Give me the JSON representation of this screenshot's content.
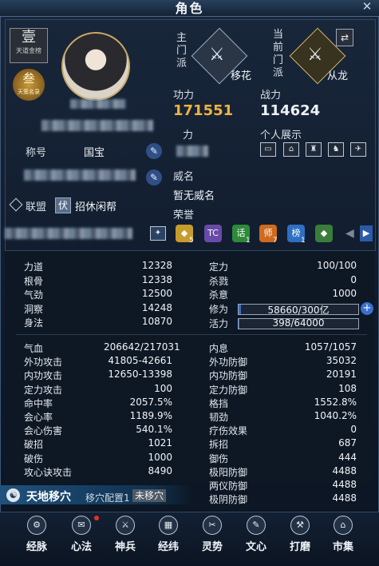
{
  "window": {
    "title": "角色",
    "close_icon": "close-icon"
  },
  "badges": {
    "rank_big": "壹",
    "rank_small": "天道金榜",
    "seal_big": "叁",
    "seal_small": "天策名录"
  },
  "profile": {
    "title_label": "称号",
    "title_value": "国宝",
    "alliance_label": "联盟",
    "alliance_tag": "伏",
    "alliance_value": "招休闲帮"
  },
  "school": {
    "main_label_lines": [
      "主",
      "门",
      "派"
    ],
    "main_name": "移花",
    "current_label_lines": [
      "当",
      "前",
      "门",
      "派"
    ],
    "current_name": "从龙"
  },
  "power": {
    "gongli_label": "功力",
    "gongli_value": "171551",
    "zhanli_label": "战力",
    "zhanli_value": "114624",
    "hidden_label_suffix": "力",
    "personal_label": "个人展示"
  },
  "weiming": {
    "label": "威名",
    "value": "暂无威名"
  },
  "honor": {
    "label": "荣誉",
    "items": [
      {
        "icon": "honor-diamond-5",
        "text": "",
        "count": "5",
        "color": "#c79c2c"
      },
      {
        "icon": "honor-tc",
        "text": "TC",
        "count": "",
        "color": "#6a4aa8"
      },
      {
        "icon": "honor-hua",
        "text": "话",
        "count": "1",
        "color": "#2e8a3a"
      },
      {
        "icon": "honor-shi",
        "text": "师",
        "count": "7",
        "color": "#cf6a1f"
      },
      {
        "icon": "honor-bang",
        "text": "榜",
        "count": "1",
        "color": "#2d6fc2"
      },
      {
        "icon": "honor-frog",
        "text": "",
        "count": "",
        "color": "#3a7d3a"
      }
    ]
  },
  "attrs_left": [
    {
      "k": "力道",
      "v": "12328"
    },
    {
      "k": "根骨",
      "v": "12338"
    },
    {
      "k": "气劲",
      "v": "12500"
    },
    {
      "k": "洞察",
      "v": "14248"
    },
    {
      "k": "身法",
      "v": "10870"
    }
  ],
  "attrs_right": [
    {
      "k": "定力",
      "v": "100/100"
    },
    {
      "k": "杀戮",
      "v": "0"
    },
    {
      "k": "杀意",
      "v": "1000"
    }
  ],
  "xiuwei": {
    "k": "修为",
    "v": "58660/300亿",
    "fill": 0.02
  },
  "huoli": {
    "k": "活力",
    "v": "398/64000",
    "fill": 0.006
  },
  "combat_left": [
    {
      "k": "气血",
      "v": "206642/217031"
    },
    {
      "k": "外功攻击",
      "v": "41805-42661"
    },
    {
      "k": "内功攻击",
      "v": "12650-13398"
    },
    {
      "k": "定力攻击",
      "v": "100"
    },
    {
      "k": "命中率",
      "v": "2057.5%"
    },
    {
      "k": "会心率",
      "v": "1189.9%"
    },
    {
      "k": "会心伤害",
      "v": "540.1%"
    },
    {
      "k": "破招",
      "v": "1021"
    },
    {
      "k": "破伤",
      "v": "1000"
    },
    {
      "k": "攻心诀攻击",
      "v": "8490"
    }
  ],
  "combat_right": [
    {
      "k": "内息",
      "v": "1057/1057"
    },
    {
      "k": "外功防御",
      "v": "35032"
    },
    {
      "k": "内功防御",
      "v": "20191"
    },
    {
      "k": "定力防御",
      "v": "108"
    },
    {
      "k": "格挡",
      "v": "1552.8%"
    },
    {
      "k": "韧劲",
      "v": "1040.2%"
    },
    {
      "k": "疗伤效果",
      "v": "0"
    },
    {
      "k": "拆招",
      "v": "687"
    },
    {
      "k": "御伤",
      "v": "444"
    },
    {
      "k": "极阳防御",
      "v": "4488"
    },
    {
      "k": "两仪防御",
      "v": "4488"
    },
    {
      "k": "极阴防御",
      "v": "4488"
    }
  ],
  "config": {
    "title": "天地移穴",
    "sub": "移穴配置1",
    "tag": "未移穴"
  },
  "tabs": [
    {
      "label": "经脉",
      "icon": "meridian-icon"
    },
    {
      "label": "心法",
      "icon": "heart-method-icon"
    },
    {
      "label": "神兵",
      "icon": "weapon-icon"
    },
    {
      "label": "经纬",
      "icon": "grid-icon"
    },
    {
      "label": "灵势",
      "icon": "spirit-icon"
    },
    {
      "label": "文心",
      "icon": "brush-icon"
    },
    {
      "label": "打磨",
      "icon": "hammer-icon"
    },
    {
      "label": "市集",
      "icon": "market-icon"
    }
  ]
}
